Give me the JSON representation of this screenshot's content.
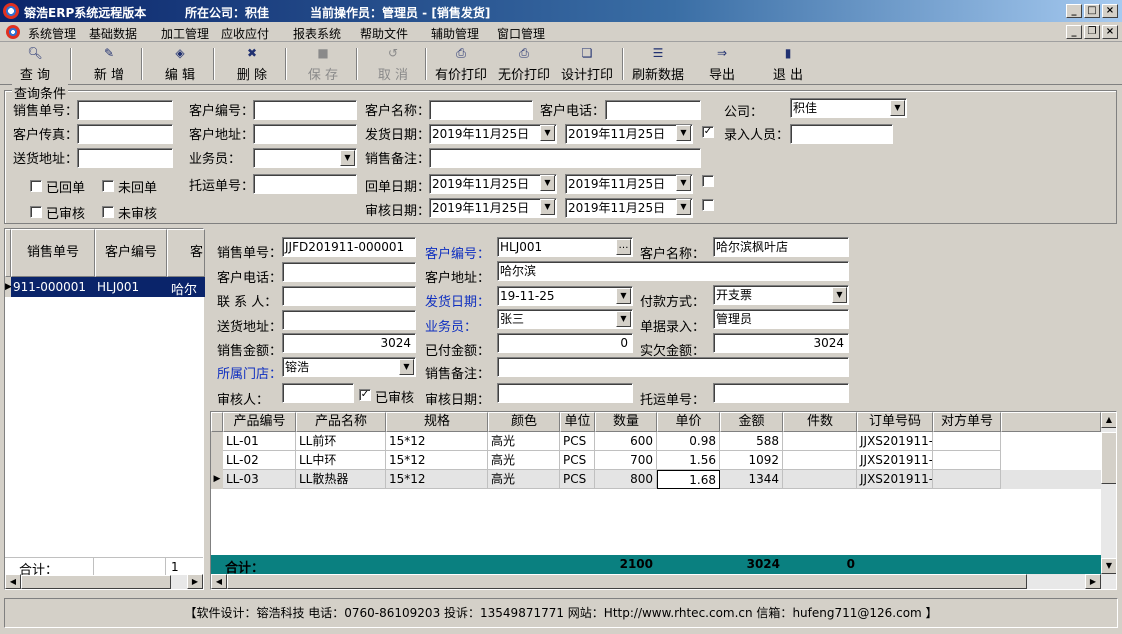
{
  "window": {
    "title": "镕浩ERP系统远程版本",
    "company_label": "所在公司：积佳",
    "operator_label": "当前操作员：管理员 - [销售发货]",
    "min": "_",
    "max": "□",
    "close": "×",
    "restore": "❐"
  },
  "menu": [
    "系统管理",
    "基础数据",
    "加工管理",
    "应收应付",
    "报表系统",
    "帮助文件",
    "辅助管理",
    "窗口管理"
  ],
  "toolbar": {
    "query": "查 询",
    "new": "新 增",
    "edit": "编 辑",
    "delete": "删 除",
    "save": "保 存",
    "cancel": "取 消",
    "print_price": "有价打印",
    "print_noprice": "无价打印",
    "print_design": "设计打印",
    "refresh": "刷新数据",
    "export": "导出",
    "exit": "退 出"
  },
  "query": {
    "legend": "查询条件",
    "sale_no": "销售单号：",
    "cust_fax": "客户传真：",
    "ship_addr": "送货地址：",
    "cust_code": "客户编号：",
    "cust_addr": "客户地址：",
    "salesman": "业务员：",
    "consign_no": "托运单号：",
    "cust_name": "客户名称：",
    "ship_date": "发货日期：",
    "sale_note": "销售备注：",
    "return_date": "回单日期：",
    "audit_date": "审核日期：",
    "cust_tel": "客户电话：",
    "company": "公司：",
    "company_value": "积佳",
    "entry_person": "录入人员：",
    "date1": "2019年11月25日",
    "date2": "2019年11月25日",
    "date3": "2019年11月25日",
    "date4": "2019年11月25日",
    "date5": "2019年11月25日",
    "date6": "2019年11月25日",
    "returned": "已回单",
    "not_returned": "未回单",
    "audited": "已审核",
    "not_audited": "未审核",
    "check_mark": "✓"
  },
  "left_list": {
    "col1": "销售单号",
    "col2": "客户编号",
    "col3": "客",
    "row_no": "911-000001",
    "row_code": "HLJ001",
    "row_name": "哈尔滨",
    "total_label": "合计：",
    "total_count": "1"
  },
  "detail": {
    "sale_no_label": "销售单号：",
    "sale_no": "JJFD201911-000001",
    "cust_tel_label": "客户电话：",
    "contact_label": "联 系 人：",
    "ship_addr_label": "送货地址：",
    "amount_label": "销售金额：",
    "amount": "3024",
    "store_label": "所属门店：",
    "store": "镕浩",
    "auditor_label": "审核人：",
    "audited": "已审核",
    "cust_code_label": "客户编号：",
    "cust_code": "HLJ001",
    "cust_addr_label": "客户地址：",
    "cust_addr": "哈尔滨",
    "ship_date_label": "发货日期：",
    "ship_date": "19-11-25",
    "salesman_label": "业务员：",
    "salesman": "张三",
    "paid_label": "已付金额：",
    "paid": "0",
    "note_label": "销售备注：",
    "audit_date_label": "审核日期：",
    "cust_name_label": "客户名称：",
    "cust_name": "哈尔滨枫叶店",
    "pay_label": "付款方式：",
    "pay": "开支票",
    "entry_label": "单据录入：",
    "entry": "管理员",
    "owe_label": "实欠金额：",
    "owe": "3024",
    "consign_label": "托运单号："
  },
  "grid": {
    "headers": [
      "产品编号",
      "产品名称",
      "规格",
      "颜色",
      "单位",
      "数量",
      "单价",
      "金额",
      "件数",
      "订单号码",
      "对方单号"
    ],
    "rows": [
      [
        "LL-01",
        "LL前环",
        "15*12",
        "高光",
        "PCS",
        "600",
        "0.98",
        "588",
        "",
        "JJXS201911-",
        ""
      ],
      [
        "LL-02",
        "LL中环",
        "15*12",
        "高光",
        "PCS",
        "700",
        "1.56",
        "1092",
        "",
        "JJXS201911-",
        ""
      ],
      [
        "LL-03",
        "LL散热器",
        "15*12",
        "高光",
        "PCS",
        "800",
        "1.68",
        "1344",
        "",
        "JJXS201911-",
        ""
      ]
    ],
    "total_label": "合计：",
    "total_qty": "2100",
    "total_amount": "3024",
    "total_pieces": "0"
  },
  "footer": "【软件设计：镕浩科技 电话：0760-86109203 投诉：13549871771 网站：Http://www.rhtec.com.cn 信箱：hufeng711@126.com 】"
}
